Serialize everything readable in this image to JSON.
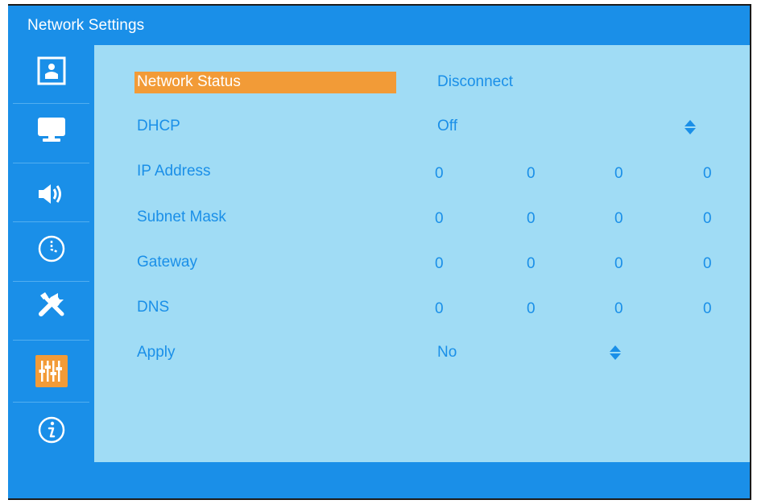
{
  "header": {
    "title": "Network Settings"
  },
  "sidebar": {
    "items": [
      {
        "icon": "picture-icon",
        "active": false
      },
      {
        "icon": "monitor-icon",
        "active": false
      },
      {
        "icon": "speaker-icon",
        "active": false
      },
      {
        "icon": "clock-icon",
        "active": false
      },
      {
        "icon": "tools-icon",
        "active": false
      },
      {
        "icon": "sliders-icon",
        "active": true
      },
      {
        "icon": "info-icon",
        "active": false
      }
    ]
  },
  "settings": {
    "network_status": {
      "label": "Network Status",
      "value": "Disconnect"
    },
    "dhcp": {
      "label": "DHCP",
      "value": "Off"
    },
    "ip_address": {
      "label": "IP Address",
      "octets": [
        "0",
        "0",
        "0",
        "0"
      ]
    },
    "subnet_mask": {
      "label": "Subnet Mask",
      "octets": [
        "0",
        "0",
        "0",
        "0"
      ]
    },
    "gateway": {
      "label": "Gateway",
      "octets": [
        "0",
        "0",
        "0",
        "0"
      ]
    },
    "dns": {
      "label": "DNS",
      "octets": [
        "0",
        "0",
        "0",
        "0"
      ]
    },
    "apply": {
      "label": "Apply",
      "value": "No"
    }
  },
  "colors": {
    "header": "#1a8fe8",
    "content": "#a0dcf5",
    "highlight": "#f29b37",
    "text": "#1a8fe8"
  }
}
